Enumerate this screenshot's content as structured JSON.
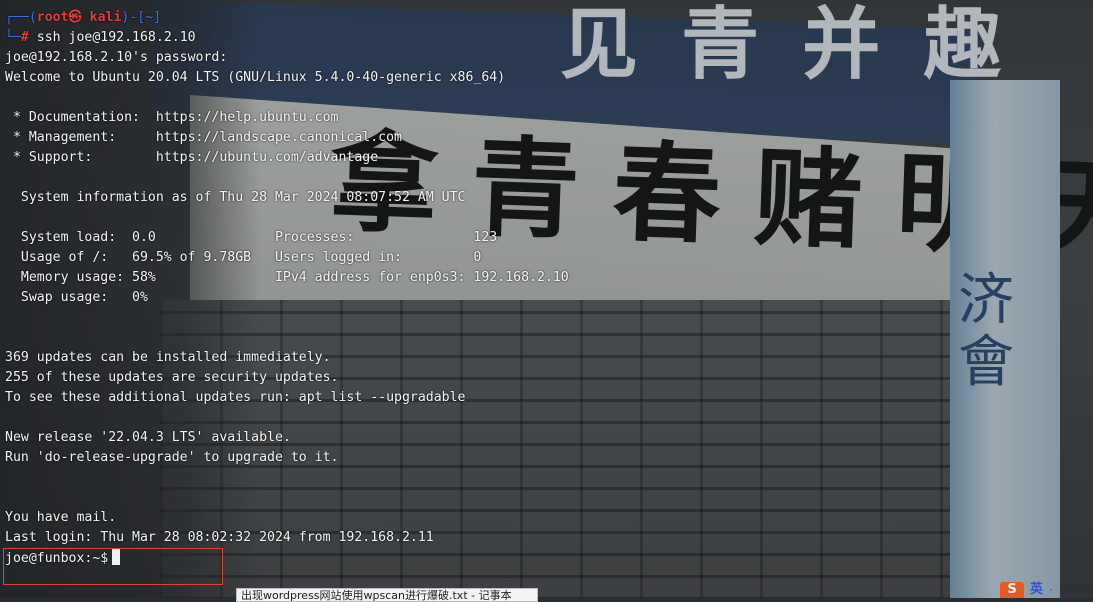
{
  "wallpaper": {
    "top_banner": "见 青 并 趣",
    "main_banner": "拿 青 春 赌 明 天",
    "side_banner": "济 會"
  },
  "terminal": {
    "prompt_top": {
      "open": "┌──(",
      "user_host": "root㉿ kali",
      "close": ")-[~]"
    },
    "prompt_cmd": {
      "branch": "└─",
      "symbol": "#",
      "command": " ssh joe@192.168.2.10"
    },
    "lines": [
      "joe@192.168.2.10's password:",
      "Welcome to Ubuntu 20.04 LTS (GNU/Linux 5.4.0-40-generic x86_64)",
      "",
      " * Documentation:  https://help.ubuntu.com",
      " * Management:     https://landscape.canonical.com",
      " * Support:        https://ubuntu.com/advantage",
      "",
      "  System information as of Thu 28 Mar 2024 08:07:52 AM UTC",
      "",
      "  System load:  0.0               Processes:               123",
      "  Usage of /:   69.5% of 9.78GB   Users logged in:         0",
      "  Memory usage: 58%               IPv4 address for enp0s3: 192.168.2.10",
      "  Swap usage:   0%",
      "",
      "",
      "369 updates can be installed immediately.",
      "255 of these updates are security updates.",
      "To see these additional updates run: apt list --upgradable",
      "",
      "New release '22.04.3 LTS' available.",
      "Run 'do-release-upgrade' to upgrade to it.",
      "",
      "",
      "You have mail.",
      "Last login: Thu Mar 28 08:02:32 2024 from 192.168.2.11"
    ],
    "final_prompt": "joe@funbox:~$"
  },
  "taskbar": {
    "tooltip": "出现wordpress网站使用wpscan进行爆破.txt - 记事本",
    "ime_logo": "S",
    "ime_lang": "英",
    "ime_more": "·"
  },
  "colors": {
    "prompt_frame": "#3d6fe0",
    "prompt_user": "#e03c3c",
    "text": "#f4f4f4",
    "highlight_box": "#d8453a"
  }
}
